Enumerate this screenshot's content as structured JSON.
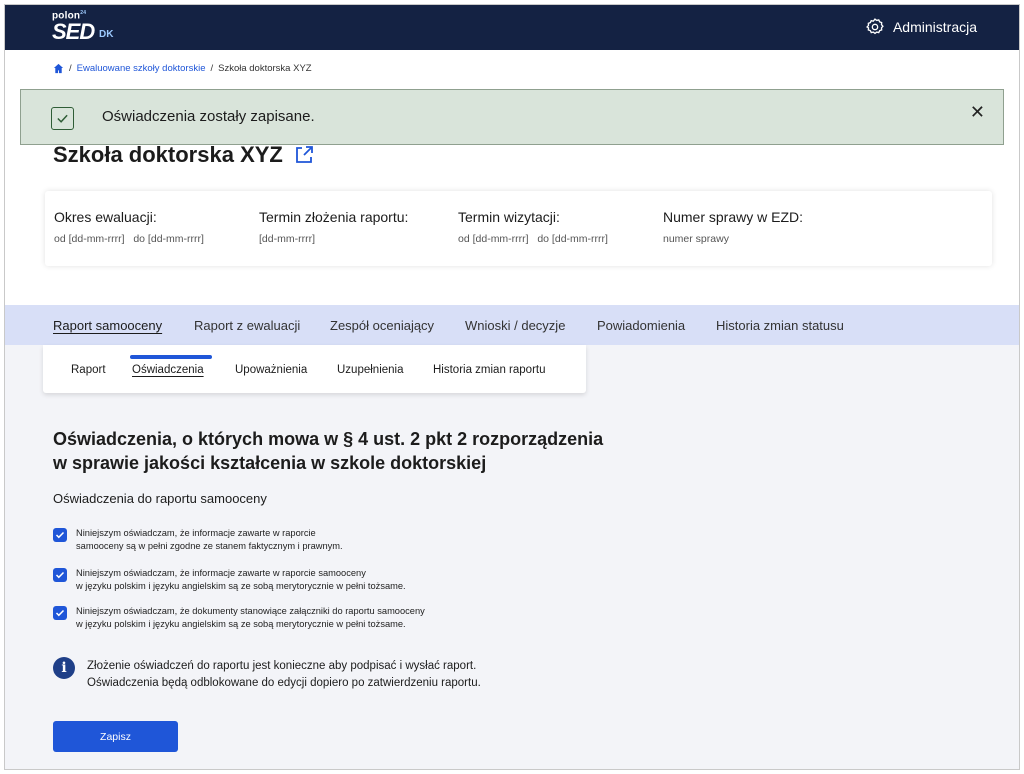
{
  "header": {
    "logo_polon": "polon",
    "logo_superscript": "24",
    "logo_main": "SED",
    "logo_suffix": "DK",
    "admin_label": "Administracja"
  },
  "breadcrumb": {
    "items": [
      "Ewaluowane szkoły doktorskie",
      "Szkoła doktorska XYZ"
    ],
    "separator": "/"
  },
  "toast": {
    "message": "Oświadczenia zostały zapisane.",
    "close_label": "✕"
  },
  "page_title": "Szkoła doktorska XYZ",
  "info": {
    "period_label": "Okres ewaluacji:",
    "period_value": "od [dd-mm-rrrr]   do [dd-mm-rrrr]",
    "deadline_label": "Termin złożenia raportu:",
    "deadline_value": "[dd-mm-rrrr]",
    "visit_label": "Termin wizytacji:",
    "visit_value": "od [dd-mm-rrrr]   do [dd-mm-rrrr]",
    "case_label": "Numer sprawy w EZD:",
    "case_value": "numer sprawy"
  },
  "tabs": [
    {
      "label": "Raport samooceny",
      "active": true
    },
    {
      "label": "Raport z ewaluacji",
      "active": false
    },
    {
      "label": "Zespół oceniający",
      "active": false
    },
    {
      "label": "Wnioski / decyzje",
      "active": false
    },
    {
      "label": "Powiadomienia",
      "active": false
    },
    {
      "label": "Historia zmian statusu",
      "active": false
    }
  ],
  "subtabs": [
    {
      "label": "Raport",
      "active": false
    },
    {
      "label": "Oświadczenia",
      "active": true
    },
    {
      "label": "Upoważnienia",
      "active": false
    },
    {
      "label": "Uzupełnienia",
      "active": false
    },
    {
      "label": "Historia zmian raportu",
      "active": false
    }
  ],
  "section": {
    "heading_line1": "Oświadczenia, o których mowa w § 4 ust. 2 pkt 2 rozporządzenia",
    "heading_line2": "w sprawie jakości kształcenia w szkole doktorskiej",
    "subheading": "Oświadczenia do raportu samooceny"
  },
  "declarations": [
    {
      "line1": "Niniejszym oświadczam, że informacje zawarte w raporcie",
      "line2": "samooceny są w pełni zgodne ze stanem faktycznym i prawnym.",
      "checked": true
    },
    {
      "line1": "Niniejszym oświadczam, że informacje zawarte w raporcie samooceny",
      "line2": "w języku polskim i języku angielskim są ze sobą merytorycznie w pełni tożsame.",
      "checked": true
    },
    {
      "line1": "Niniejszym oświadczam, że dokumenty stanowiące załączniki do raportu samooceny",
      "line2": "w języku polskim i języku angielskim są ze sobą merytorycznie w pełni tożsame.",
      "checked": true
    }
  ],
  "notice": {
    "line1": "Złożenie oświadczeń do raportu jest konieczne aby podpisać i wysłać raport.",
    "line2": "Oświadczenia będą odblokowane do edycji dopiero po zatwierdzeniu raportu."
  },
  "save_button": "Zapisz",
  "colors": {
    "topbar": "#142243",
    "primary": "#1f56d8",
    "toast_bg": "#d9e4da",
    "tabs_band": "#d8dff7",
    "content_bg": "#f3f4f8"
  }
}
